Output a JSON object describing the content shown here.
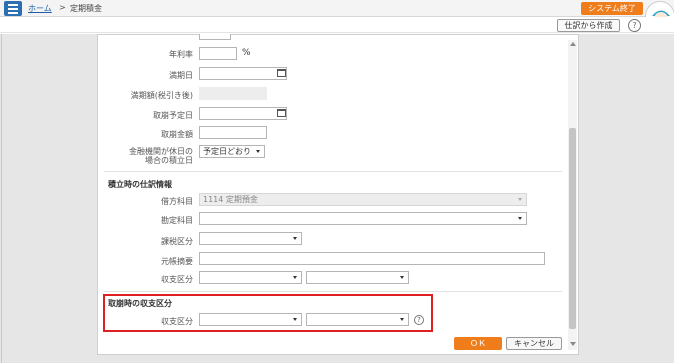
{
  "header": {
    "home_link": "ホーム",
    "separator": ">",
    "current_page": "定期積金",
    "system_end_button": "システム終了",
    "accent_color": "#f07d1c"
  },
  "toolbar": {
    "create_from_journal_button": "仕訳から作成",
    "help_icon": "?"
  },
  "form": {
    "annual_rate_label": "年利率",
    "annual_rate_unit": "%",
    "maturity_date_label": "満期日",
    "maturity_amount_label": "満期額(税引き後)",
    "planned_withdrawal_date_label": "取崩予定日",
    "withdrawal_amount_label": "取崩金額",
    "holiday_rule_label_line1": "金融機関が休日の",
    "holiday_rule_label_line2": "場合の積立日",
    "holiday_rule_value": "予定日どおり"
  },
  "journal_section": {
    "title": "積立時の仕訳情報",
    "debit_account_label": "借方科目",
    "debit_account_value": "1114 定期預金",
    "contra_account_label": "勘定科目",
    "tax_category_label": "課税区分",
    "ledger_memo_label": "元帳摘要",
    "income_expense_label": "収支区分"
  },
  "withdrawal_section": {
    "title": "取崩時の収支区分",
    "income_expense_label": "収支区分",
    "help_icon": "?"
  },
  "footer": {
    "ok_button": "ＯＫ",
    "cancel_button": "キャンセル"
  }
}
